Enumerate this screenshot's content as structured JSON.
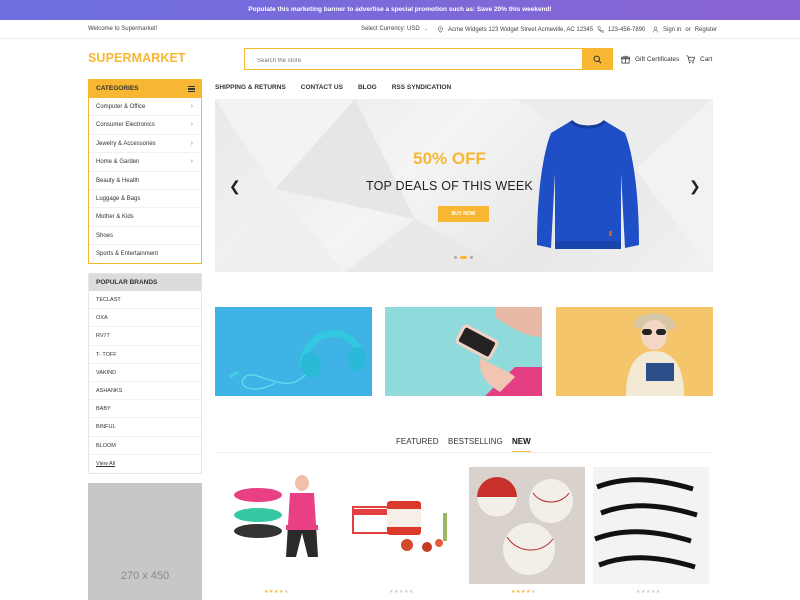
{
  "promo_banner": "Populate this marketing banner to advertise a special promotion such as: Save 20% this weekend!",
  "topbar": {
    "welcome": "Welcome to Supermarket!",
    "currency": "Select Currency: USD",
    "address": "Acme Widgets 123 Widget Street Acmeville, AC 12345",
    "phone": "123-456-7890",
    "signin": "Sign in",
    "or": "or",
    "register": "Register"
  },
  "header": {
    "logo": "SUPERMARKET",
    "search_placeholder": "Search the store",
    "gift_certificates": "Gift Certificates",
    "cart": "Cart"
  },
  "categories": {
    "title": "CATEGORIES",
    "items": [
      {
        "label": "Computer & Office",
        "has_sub": true
      },
      {
        "label": "Consumer Electronics",
        "has_sub": true
      },
      {
        "label": "Jewelry & Accessories",
        "has_sub": true
      },
      {
        "label": "Home & Garden",
        "has_sub": true
      },
      {
        "label": "Beauty & Health",
        "has_sub": false
      },
      {
        "label": "Luggage & Bags",
        "has_sub": false
      },
      {
        "label": "Mother & Kids",
        "has_sub": false
      },
      {
        "label": "Shoes",
        "has_sub": false
      },
      {
        "label": "Sports & Entertainment",
        "has_sub": false
      }
    ]
  },
  "brands": {
    "title": "POPULAR BRANDS",
    "items": [
      "TECLAST",
      "OXA",
      "RV77",
      "T- TOFF",
      "VAKIND",
      "ASHANKS",
      "BABY",
      "BINFUL",
      "BLOOM"
    ],
    "view_all": "View All"
  },
  "ad_placeholder": "270 x 450",
  "nav": [
    "SHIPPING & RETURNS",
    "CONTACT US",
    "BLOG",
    "RSS SYNDICATION"
  ],
  "hero": {
    "headline": "50% OFF",
    "subline": "TOP DEALS OF THIS WEEK",
    "button": "BUY NOW",
    "slides": 3,
    "active_slide": 2
  },
  "product_tabs": {
    "items": [
      "FEATURED",
      "BESTSELLING",
      "NEW"
    ],
    "active": "NEW"
  },
  "products": [
    {
      "name": "resistance bands",
      "rating": 4
    },
    {
      "name": "goji berry cream",
      "rating": 0
    },
    {
      "name": "leather baseballs",
      "rating": 4
    },
    {
      "name": "false eyelashes",
      "rating": 0
    }
  ],
  "colors": {
    "accent": "#f7b733",
    "promo_start": "#6d6fe0",
    "promo_end": "#8a63d2"
  }
}
